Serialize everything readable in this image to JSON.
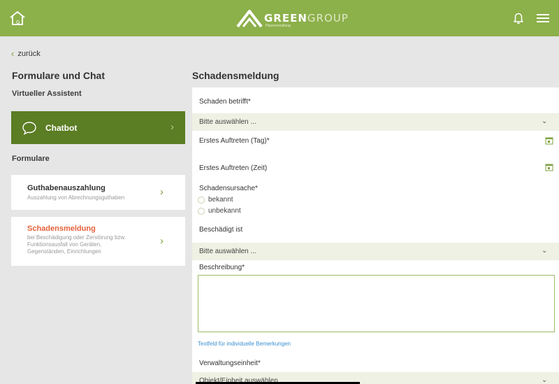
{
  "header": {
    "logo_word_bold": "GREEN",
    "logo_word_light": "GROUP",
    "logo_tagline": "Hausverwaltung",
    "home_icon": "home-icon",
    "bell_icon": "bell-icon",
    "menu_icon": "hamburger-menu-icon",
    "bar_color": "#8cb04a"
  },
  "sidebar": {
    "back_label": "zurück",
    "title": "Formulare und Chat",
    "assistant_heading": "Virtueller Assistent",
    "chatbot": {
      "label": "Chatbot",
      "color": "#5b7d23"
    },
    "forms_heading": "Formulare",
    "forms": [
      {
        "title": "Guthabenauszahlung",
        "description": "Auszahlung von Abrechnungsguthaben"
      },
      {
        "title": "Schadensmeldung",
        "description": "bei Beschädigung oder Zerstörung bzw.\nFunktionsausfall von Geräten,\nGegenständen, Einrichtungen"
      }
    ]
  },
  "form": {
    "title": "Schadensmeldung",
    "damage_concerns_label": "Schaden betrifft*",
    "damage_concerns_value": "Bitte auswählen ...",
    "first_day_label": "Erstes Auftreten (Tag)*",
    "first_time_label": "Erstes Auftreten (Zeit)",
    "cause_label": "Schadensursache*",
    "cause_options": [
      "bekannt",
      "unbekannt"
    ],
    "damaged_label": "Beschädigt ist",
    "damaged_value": "Bitte auswählen ...",
    "description_label": "Beschreibung*",
    "description_value": "",
    "description_hint": "Textfeld für individuelle Bemerkungen",
    "unit_label": "Verwaltungseinheit*",
    "unit_value": "Objekt/Einheit auswählen"
  }
}
